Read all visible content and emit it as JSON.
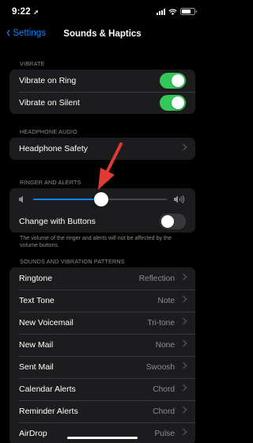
{
  "status": {
    "time": "9:22",
    "time_arrow": "➚"
  },
  "nav": {
    "back_label": "Settings",
    "title": "Sounds & Haptics"
  },
  "vibrate": {
    "header": "VIBRATE",
    "rows": [
      {
        "label": "Vibrate on Ring",
        "on": true
      },
      {
        "label": "Vibrate on Silent",
        "on": true
      }
    ]
  },
  "headphone": {
    "header": "HEADPHONE AUDIO",
    "row_label": "Headphone Safety"
  },
  "ringer": {
    "header": "RINGER AND ALERTS",
    "volume_level": 0.51,
    "change_with_buttons_label": "Change with Buttons",
    "change_with_buttons_on": false,
    "note": "The volume of the ringer and alerts will not be affected by the volume buttons."
  },
  "patterns": {
    "header": "SOUNDS AND VIBRATION PATTERNS",
    "rows": [
      {
        "label": "Ringtone",
        "value": "Reflection"
      },
      {
        "label": "Text Tone",
        "value": "Note"
      },
      {
        "label": "New Voicemail",
        "value": "Tri-tone"
      },
      {
        "label": "New Mail",
        "value": "None"
      },
      {
        "label": "Sent Mail",
        "value": "Swoosh"
      },
      {
        "label": "Calendar Alerts",
        "value": "Chord"
      },
      {
        "label": "Reminder Alerts",
        "value": "Chord"
      },
      {
        "label": "AirDrop",
        "value": "Pulse"
      }
    ]
  },
  "colors": {
    "accent": "#0a84ff",
    "toggle_on": "#34c759",
    "annotation_arrow": "#e03a33"
  }
}
